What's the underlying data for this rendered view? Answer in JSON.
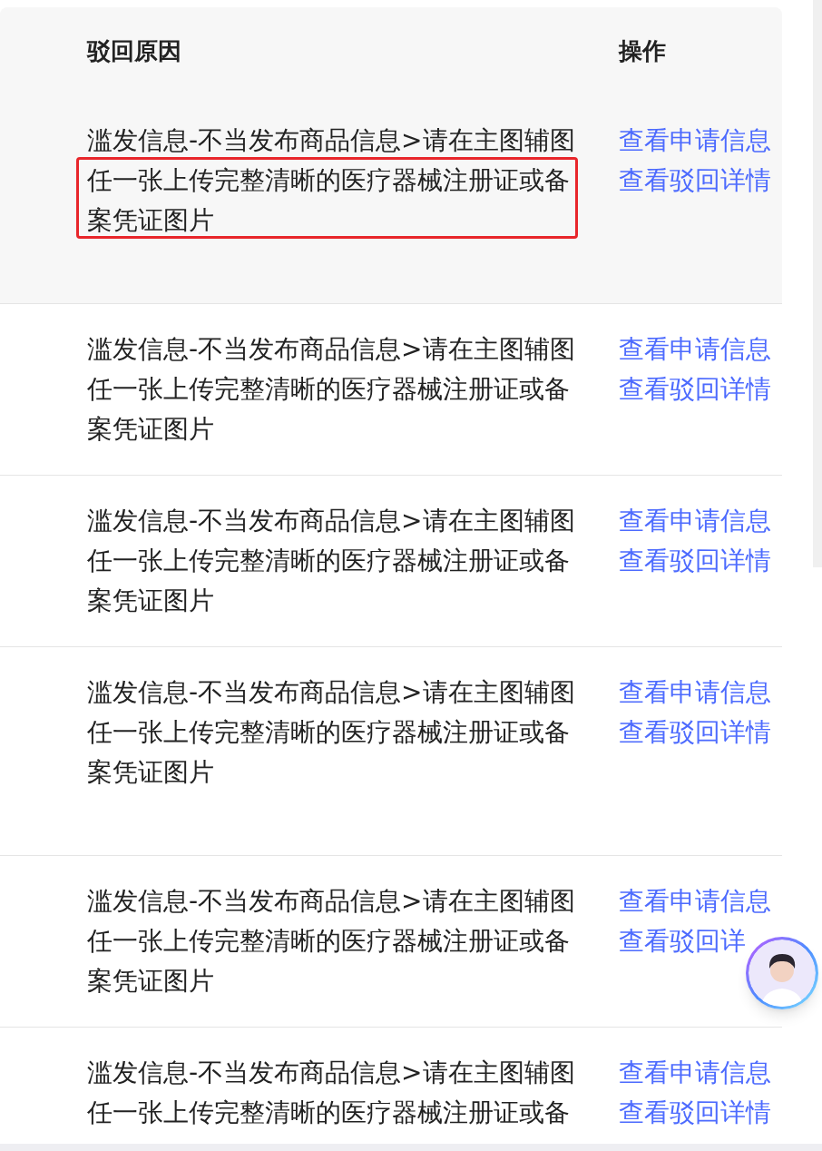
{
  "table": {
    "columns": [
      "驳回原因",
      "操作"
    ],
    "rows": [
      {
        "reason": "滥发信息-不当发布商品信息>请在主图辅图任一张上传完整清晰的医疗器械注册证或备案凭证图片",
        "actions": [
          "查看申请信息",
          "查看驳回详情"
        ],
        "highlighted": true,
        "annotated": true
      },
      {
        "reason": "滥发信息-不当发布商品信息>请在主图辅图任一张上传完整清晰的医疗器械注册证或备案凭证图片",
        "actions": [
          "查看申请信息",
          "查看驳回详情"
        ],
        "highlighted": false,
        "annotated": false
      },
      {
        "reason": "滥发信息-不当发布商品信息>请在主图辅图任一张上传完整清晰的医疗器械注册证或备案凭证图片",
        "actions": [
          "查看申请信息",
          "查看驳回详情"
        ],
        "highlighted": false,
        "annotated": false
      },
      {
        "reason": "滥发信息-不当发布商品信息>请在主图辅图任一张上传完整清晰的医疗器械注册证或备案凭证图片",
        "actions": [
          "查看申请信息",
          "查看驳回详情"
        ],
        "highlighted": false,
        "annotated": false
      },
      {
        "reason": "滥发信息-不当发布商品信息>请在主图辅图任一张上传完整清晰的医疗器械注册证或备案凭证图片",
        "actions": [
          "查看申请信息",
          "查看驳回详"
        ],
        "highlighted": false,
        "annotated": false
      },
      {
        "reason": "滥发信息-不当发布商品信息>请在主图辅图任一张上传完整清晰的医疗器械注册证或备",
        "actions": [
          "查看申请信息",
          "查看驳回详情"
        ],
        "highlighted": false,
        "annotated": false
      }
    ]
  }
}
